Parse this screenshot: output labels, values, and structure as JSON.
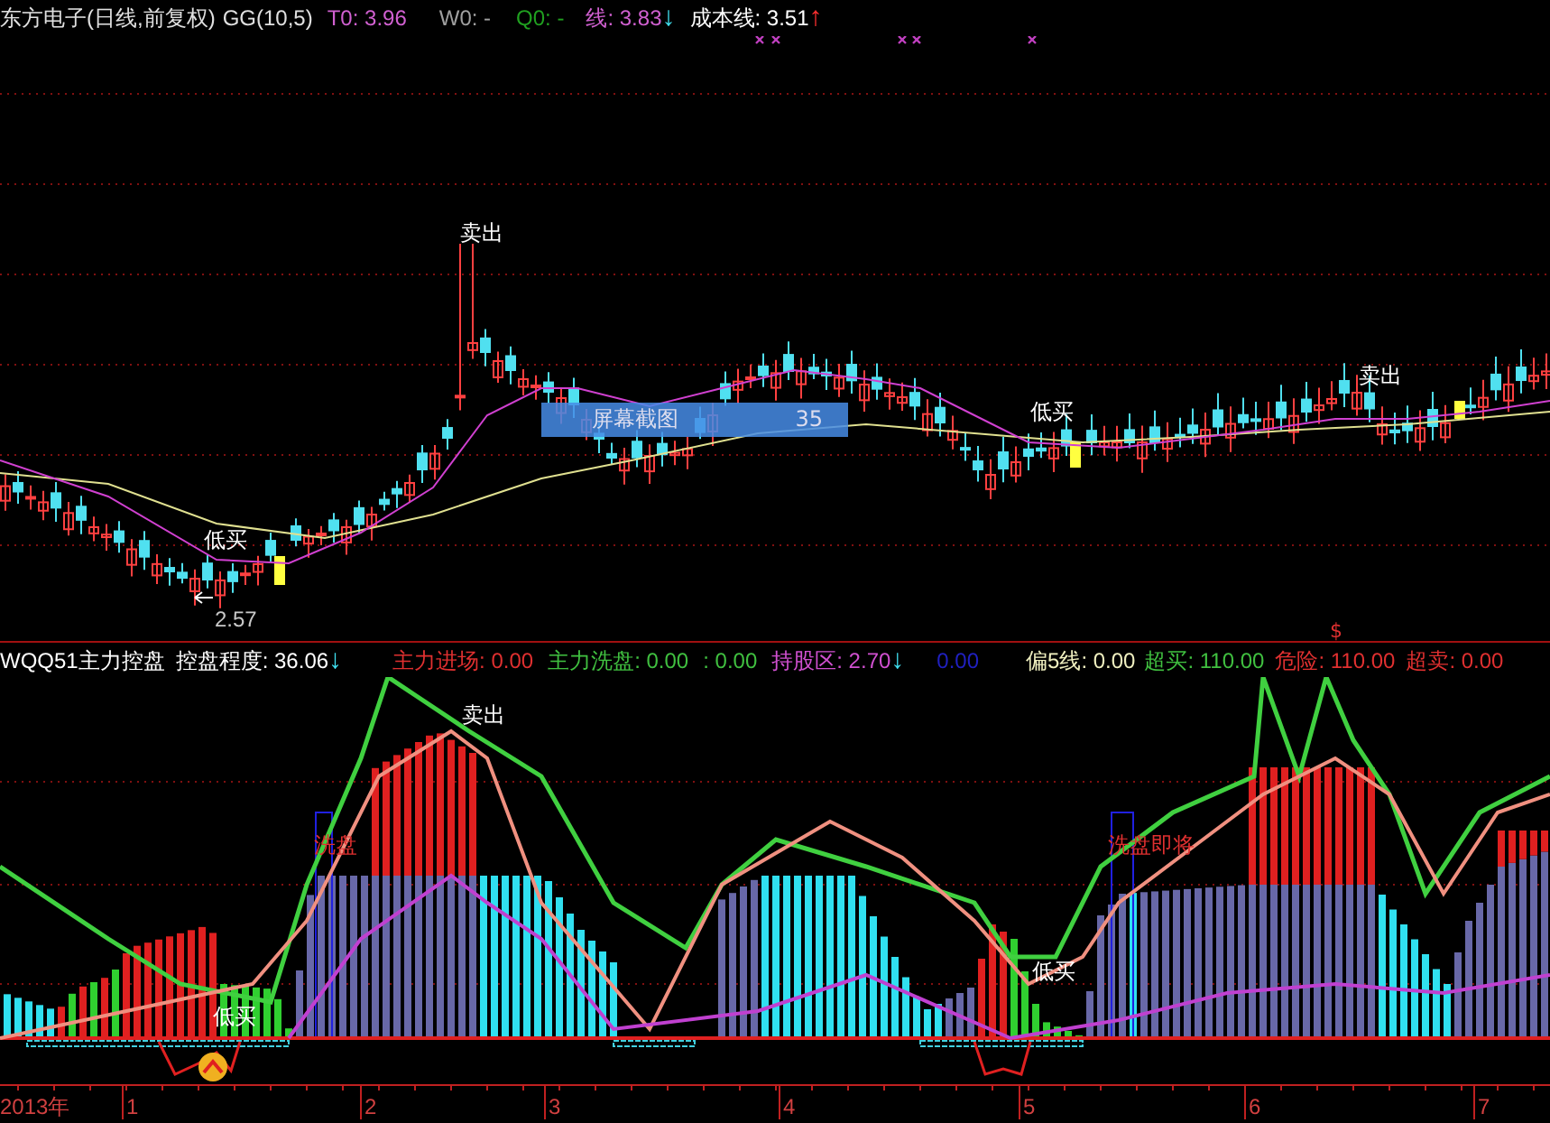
{
  "price_header": [
    {
      "text": "东方电子(日线,前复权)",
      "color": "#e0e0e0"
    },
    {
      "text": "GG(10,5)",
      "color": "#e0e0e0"
    },
    {
      "text": "T0: 3.96",
      "color": "#d060d0"
    },
    {
      "text": "W0: -",
      "color": "#a0a0a0"
    },
    {
      "text": "Q0: -",
      "color": "#20a020"
    },
    {
      "text": "线: 3.83",
      "color": "#d060d0"
    },
    {
      "text": "↓",
      "color": "#40e0f0"
    },
    {
      "text": "成本线: 3.51",
      "color": "#ffffff"
    },
    {
      "text": "↑",
      "color": "#ff3030"
    }
  ],
  "price_chart": {
    "annotations": [
      {
        "kind": "signal",
        "text": "卖出"
      },
      {
        "kind": "signal",
        "text": "卖出"
      },
      {
        "kind": "signal",
        "text": "低买"
      },
      {
        "kind": "signal",
        "text": "低买"
      },
      {
        "kind": "price",
        "text": "2.57"
      }
    ],
    "tooltip": {
      "label": "屏幕截图",
      "value": "35"
    }
  },
  "indicator_header": [
    {
      "text": "WQQ51主力控盘",
      "color": "#ffffff"
    },
    {
      "text": "控盘程度: 36.06",
      "color": "#ffffff"
    },
    {
      "text": "↓",
      "color": "#40e0f0"
    },
    {
      "text": "主力进场: 0.00",
      "color": "#e03030"
    },
    {
      "text": "主力洗盘: 0.00",
      "color": "#40c040"
    },
    {
      "text": ": 0.00",
      "color": "#40c040"
    },
    {
      "text": "持股区: 2.70",
      "color": "#d050d0"
    },
    {
      "text": "↓",
      "color": "#40e0f0"
    },
    {
      "text": "0.00",
      "color": "#2020c0"
    },
    {
      "text": "偏5线: 0.00",
      "color": "#f0f0c0"
    },
    {
      "text": "超买: 110.00",
      "color": "#40c040"
    },
    {
      "text": "危险: 110.00",
      "color": "#e03030"
    },
    {
      "text": "超卖: 0.00",
      "color": "#e03030"
    }
  ],
  "indicator_chart": {
    "marker": "$",
    "annotations": [
      {
        "kind": "signal",
        "text": "卖出"
      },
      {
        "kind": "wash",
        "text": "洗盘"
      },
      {
        "kind": "wash",
        "text": "洗盘即将"
      },
      {
        "kind": "signal",
        "text": "低买"
      },
      {
        "kind": "signal",
        "text": "低买"
      }
    ]
  },
  "time_axis": [
    "2013年",
    "1",
    "2",
    "3",
    "4",
    "5",
    "6",
    "7"
  ]
}
